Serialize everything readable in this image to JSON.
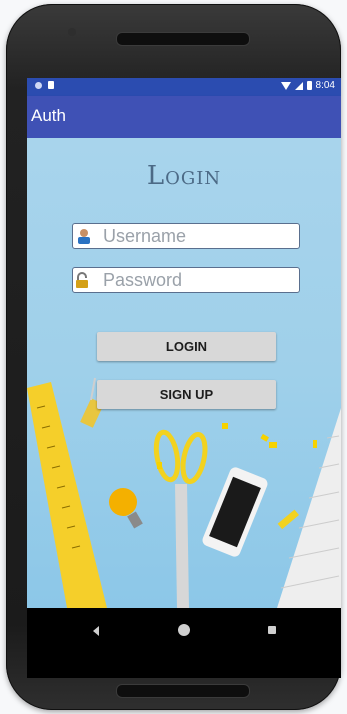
{
  "status_bar": {
    "time": "8:04"
  },
  "app_bar": {
    "title": "Auth"
  },
  "login": {
    "heading": "Login",
    "username_placeholder": "Username",
    "password_placeholder": "Password",
    "login_button": "LOGIN",
    "signup_button": "SIGN UP"
  },
  "icons": [
    "user-icon",
    "lock-icon",
    "back-icon",
    "home-icon",
    "recent-apps-icon",
    "wifi-icon",
    "signal-icon",
    "battery-icon"
  ],
  "colors": {
    "status_bar": "#2b4cb0",
    "app_bar": "#3f51b5",
    "background": "#9fd0ea",
    "heading": "#4c6a86",
    "button": "#d8d8d8"
  }
}
